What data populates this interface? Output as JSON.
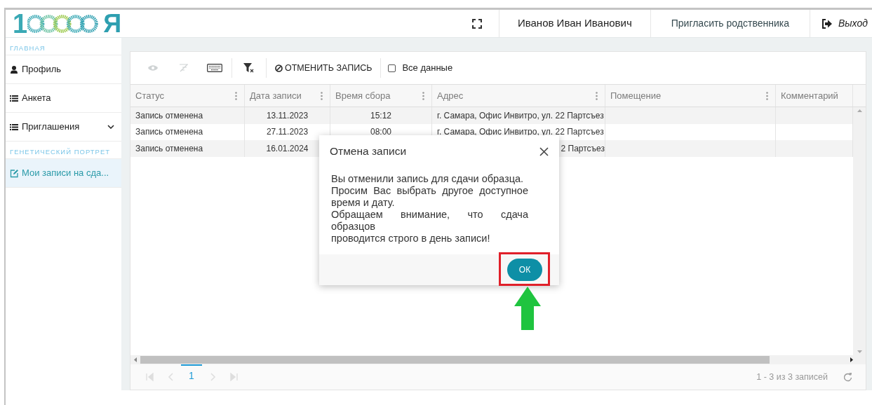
{
  "header": {
    "logo": {
      "first": "1",
      "last": "Я"
    },
    "user_name": "Иванов Иван Иванович",
    "invite_link": "Пригласить родственника",
    "logout": "Выход"
  },
  "sidebar": {
    "sections": [
      {
        "title": "ГЛАВНАЯ",
        "items": [
          {
            "label": "Профиль",
            "kind": "user",
            "selected": false
          },
          {
            "label": "Анкета",
            "kind": "list",
            "selected": false
          },
          {
            "label": "Приглашения",
            "kind": "list",
            "selected": false,
            "expanded": false
          }
        ]
      },
      {
        "title": "ГЕНЕТИЧЕСКИЙ ПОРТРЕТ",
        "items": [
          {
            "label": "Мои записи на сда...",
            "kind": "edit",
            "selected": true
          }
        ]
      }
    ]
  },
  "toolbar": {
    "items": [
      {
        "kind": "eye",
        "disabled": true
      },
      {
        "kind": "columns",
        "disabled": true
      },
      {
        "kind": "keyboard",
        "disabled": false
      },
      {
        "kind": "filter",
        "disabled": false
      },
      {
        "kind": "action",
        "label": "ОТМЕНИТЬ ЗАПИСЬ"
      },
      {
        "kind": "checkbox",
        "label": "Все данные",
        "checked": false
      }
    ]
  },
  "table": {
    "columns": [
      {
        "label": "Статус",
        "menu": true
      },
      {
        "label": "Дата записи",
        "menu": true
      },
      {
        "label": "Время сбора",
        "menu": true
      },
      {
        "label": "Адрес",
        "menu": true
      },
      {
        "label": "Помещение",
        "menu": true
      },
      {
        "label": "Комментарий",
        "menu": false
      }
    ],
    "rows": [
      {
        "status": "Запись отменена",
        "date": "13.11.2023",
        "time": "15:12",
        "address": "г. Самара, Офис Инвитро, ул. 22 Партсъез"
      },
      {
        "status": "Запись отменена",
        "date": "27.11.2023",
        "time": "08:00",
        "address": "г. Самара, Офис Инвитро, ул. 22 Партсъез"
      },
      {
        "status": "Запись отменена",
        "date": "16.01.2024",
        "address_tail": "2 Партсъез"
      }
    ]
  },
  "pager": {
    "nav": [
      {
        "kind": "first",
        "disabled": true
      },
      {
        "kind": "prev",
        "disabled": true
      },
      {
        "kind": "next",
        "disabled": true
      },
      {
        "kind": "last",
        "disabled": true
      }
    ],
    "pages": [
      {
        "label": "1",
        "selected": true
      }
    ],
    "summary": "1 - 3 из 3 записей"
  },
  "dialog": {
    "title": "Отмена записи",
    "paragraphs": [
      "Вы отменили запись для сдачи образца.",
      "Просим Вас выбрать другое доступное время и дату.",
      "Обращаем внимание, что сдача образцов",
      "проводится строго в день записи!"
    ],
    "ok_button": "ОК"
  }
}
